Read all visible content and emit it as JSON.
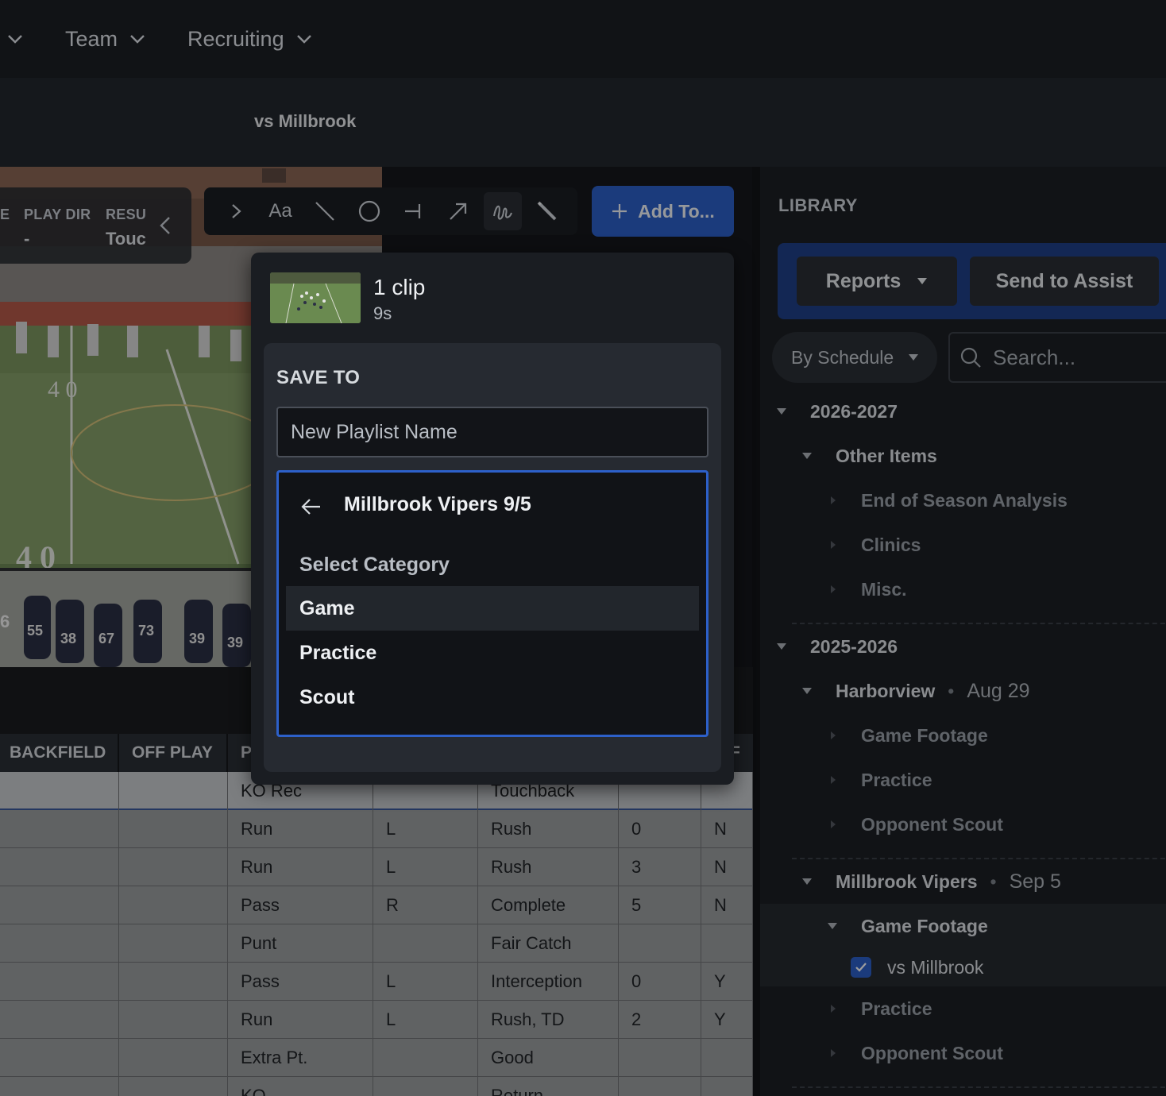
{
  "topnav": {
    "items": [
      {
        "label": "Team"
      },
      {
        "label": "Recruiting"
      }
    ]
  },
  "subheader": {
    "title": "vs Millbrook"
  },
  "video": {
    "info": {
      "play_dir_label": "PLAY DIR",
      "play_dir_value": "-",
      "result_label": "RESU",
      "result_value": "Touc",
      "edge_label": "E"
    },
    "left_number": "6",
    "field_markings": {
      "yard_top": "4 0",
      "yard_bottom": "4 0"
    },
    "jersey_numbers": [
      "55",
      "38",
      "67",
      "73",
      "39",
      "39"
    ]
  },
  "toolbar": {
    "tools": [
      {
        "name": "expand",
        "icon": "chevron-right-icon"
      },
      {
        "name": "text",
        "label": "Aa"
      },
      {
        "name": "line",
        "icon": "line-icon"
      },
      {
        "name": "circle",
        "icon": "circle-icon"
      },
      {
        "name": "block",
        "icon": "block-line-icon"
      },
      {
        "name": "arrow",
        "icon": "arrow-icon"
      },
      {
        "name": "freehand",
        "icon": "freehand-icon",
        "active": true
      },
      {
        "name": "pen",
        "icon": "pen-icon"
      }
    ],
    "add_to_label": "Add To..."
  },
  "table": {
    "columns": [
      "BACKFIELD",
      "OFF PLAY",
      "P",
      "",
      "",
      "",
      "F"
    ],
    "rows": [
      [
        "",
        "",
        "KO Rec",
        "",
        "Touchback",
        "",
        ""
      ],
      [
        "",
        "",
        "Run",
        "L",
        "Rush",
        "0",
        "N"
      ],
      [
        "",
        "",
        "Run",
        "L",
        "Rush",
        "3",
        "N"
      ],
      [
        "",
        "",
        "Pass",
        "R",
        "Complete",
        "5",
        "N"
      ],
      [
        "",
        "",
        "Punt",
        "",
        "Fair Catch",
        "",
        ""
      ],
      [
        "",
        "",
        "Pass",
        "L",
        "Interception",
        "0",
        "Y"
      ],
      [
        "",
        "",
        "Run",
        "L",
        "Rush, TD",
        "2",
        "Y"
      ],
      [
        "",
        "",
        "Extra Pt.",
        "",
        "Good",
        "",
        ""
      ],
      [
        "",
        "",
        "KO",
        "",
        "Return",
        "",
        ""
      ]
    ]
  },
  "library": {
    "title": "LIBRARY",
    "reports_label": "Reports",
    "send_label": "Send to Assist",
    "filter_label": "By Schedule",
    "search_placeholder": "Search...",
    "tree": {
      "season1": "2026-2027",
      "other_items": "Other Items",
      "end_of_season": "End of Season Analysis",
      "clinics": "Clinics",
      "misc": "Misc.",
      "season2": "2025-2026",
      "harborview": "Harborview",
      "harborview_date": "Aug 29",
      "hv_game_footage": "Game Footage",
      "hv_practice": "Practice",
      "hv_opponent_scout": "Opponent Scout",
      "millbrook": "Millbrook Vipers",
      "millbrook_date": "Sep 5",
      "mv_game_footage": "Game Footage",
      "vs_millbrook": "vs Millbrook",
      "mv_practice": "Practice",
      "mv_opponent_scout": "Opponent Scout"
    }
  },
  "popover": {
    "clip_count": "1 clip",
    "clip_duration": "9s",
    "save_to_label": "SAVE TO",
    "playlist_placeholder": "New Playlist Name",
    "category_header": "Millbrook Vipers 9/5",
    "select_category_label": "Select Category",
    "categories": [
      "Game",
      "Practice",
      "Scout"
    ]
  },
  "colors": {
    "accent": "#2d60c9",
    "panel_bg": "#1c1f24",
    "table_row": "#9c9ea1"
  }
}
